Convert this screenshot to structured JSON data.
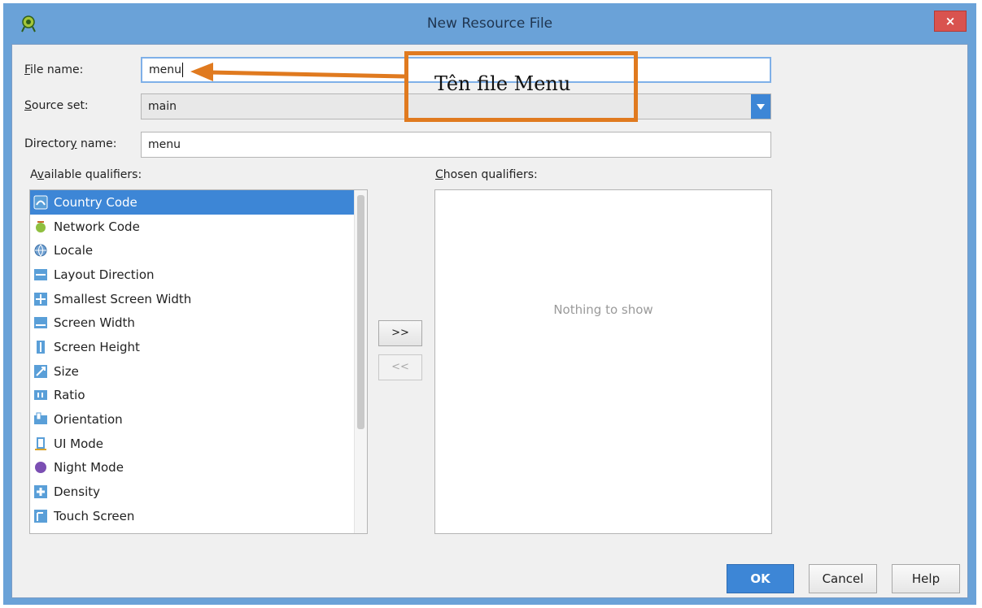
{
  "window": {
    "title": "New Resource File",
    "close_label": "×"
  },
  "form": {
    "file_name": {
      "label_underline": "F",
      "label_rest": "ile name:",
      "value": "menu"
    },
    "source_set": {
      "label_underline": "S",
      "label_rest": "ource set:",
      "value": "main"
    },
    "directory_name": {
      "label_before": "Director",
      "label_underline": "y",
      "label_after": " name:",
      "value": "menu"
    }
  },
  "available_qualifiers": {
    "label_before": "A",
    "label_underline": "v",
    "label_after": "ailable qualifiers:",
    "items": [
      {
        "label": "Country Code",
        "icon": "country-code-icon",
        "selected": true
      },
      {
        "label": "Network Code",
        "icon": "network-code-icon",
        "selected": false
      },
      {
        "label": "Locale",
        "icon": "globe-icon",
        "selected": false
      },
      {
        "label": "Layout Direction",
        "icon": "layout-direction-icon",
        "selected": false
      },
      {
        "label": "Smallest Screen Width",
        "icon": "smallest-screen-width-icon",
        "selected": false
      },
      {
        "label": "Screen Width",
        "icon": "screen-width-icon",
        "selected": false
      },
      {
        "label": "Screen Height",
        "icon": "screen-height-icon",
        "selected": false
      },
      {
        "label": "Size",
        "icon": "size-icon",
        "selected": false
      },
      {
        "label": "Ratio",
        "icon": "ratio-icon",
        "selected": false
      },
      {
        "label": "Orientation",
        "icon": "orientation-icon",
        "selected": false
      },
      {
        "label": "UI Mode",
        "icon": "ui-mode-icon",
        "selected": false
      },
      {
        "label": "Night Mode",
        "icon": "night-mode-icon",
        "selected": false
      },
      {
        "label": "Density",
        "icon": "density-icon",
        "selected": false
      },
      {
        "label": "Touch Screen",
        "icon": "touch-screen-icon",
        "selected": false
      }
    ]
  },
  "chosen_qualifiers": {
    "label_underline": "C",
    "label_rest": "hosen qualifiers:",
    "empty_text": "Nothing to show"
  },
  "transfer": {
    "add_label": ">>",
    "remove_label": "<<"
  },
  "buttons": {
    "ok": "OK",
    "cancel": "Cancel",
    "help": "Help"
  },
  "annotation": {
    "text": "Tên file Menu",
    "color": "#e07a1f"
  },
  "colors": {
    "accent": "#3d86d6",
    "titlebar": "#6aa2d8",
    "close": "#d9534f"
  }
}
